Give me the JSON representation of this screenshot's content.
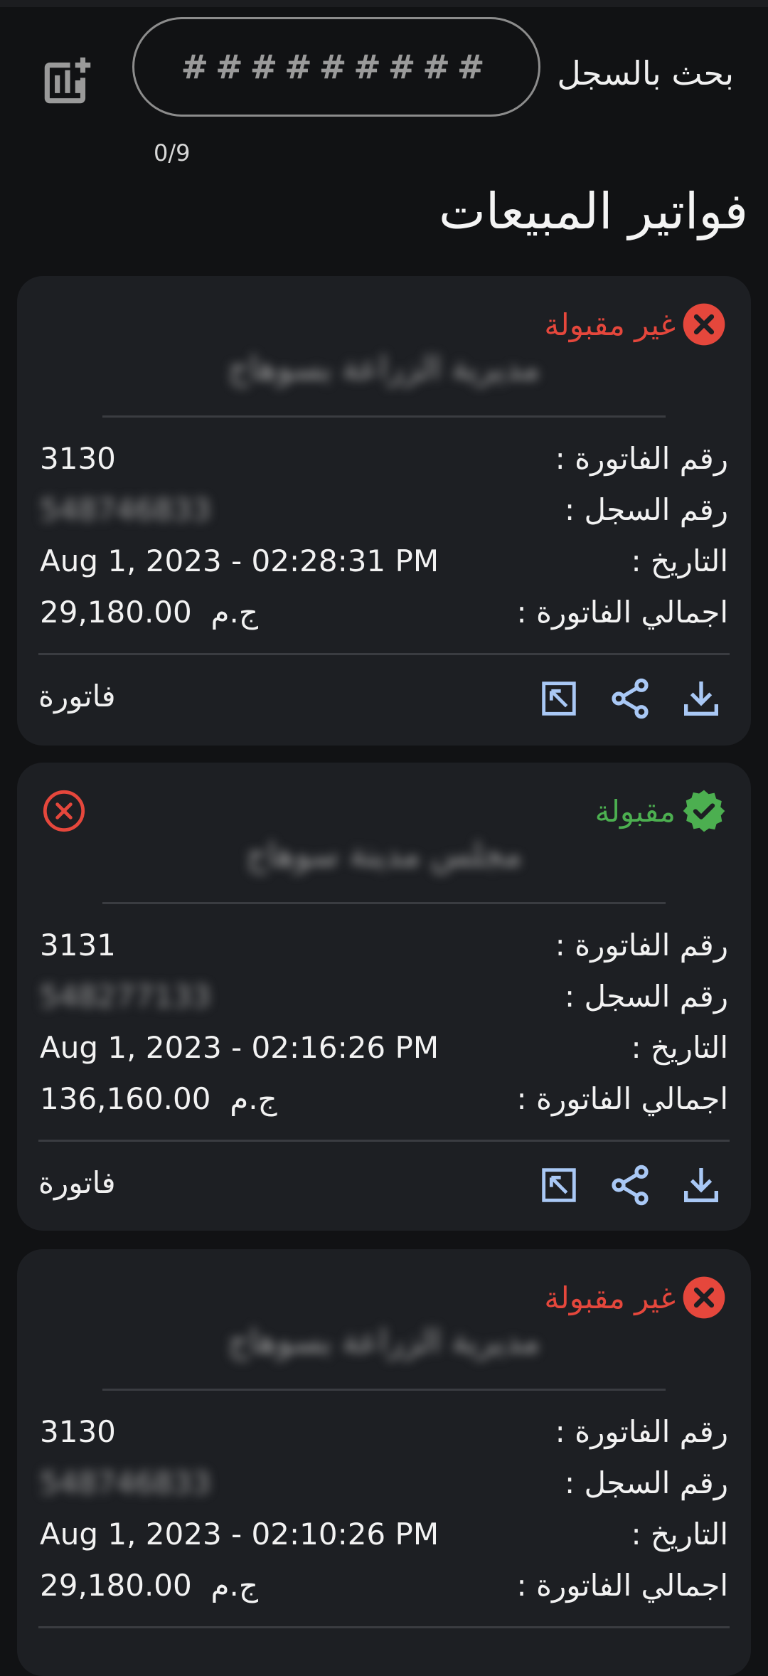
{
  "search": {
    "label": "بحث بالسجل",
    "value": "#########",
    "counter": "0/9"
  },
  "page_title": "فواتير المبيعات",
  "field_labels": {
    "invoice_number": "رقم الفاتورة :",
    "registry_number": "رقم السجل :",
    "date": "التاريخ :",
    "total": "اجمالي الفاتورة :"
  },
  "invoice_link_label": "فاتورة",
  "colors": {
    "rejected": "#e5473c",
    "accepted": "#4caf50",
    "action_icon": "#a9c8f5"
  },
  "invoices": [
    {
      "status": "غير مقبولة",
      "status_type": "rejected",
      "company_name": "مديرية الزراعة بسوهاج",
      "invoice_number": "3130",
      "registry_number": "548746833",
      "date": "Aug 1, 2023 - 02:28:31 PM",
      "total": "29,180.00",
      "currency": "ج.م"
    },
    {
      "status": "مقبولة",
      "status_type": "accepted",
      "company_name": "مجلس مدينة سوهاج",
      "invoice_number": "3131",
      "registry_number": "548277133",
      "date": "Aug 1, 2023 - 02:16:26 PM",
      "total": "136,160.00",
      "currency": "ج.م"
    },
    {
      "status": "غير مقبولة",
      "status_type": "rejected",
      "company_name": "مديرية الزراعة بسوهاج",
      "invoice_number": "3130",
      "registry_number": "548746833",
      "date": "Aug 1, 2023 - 02:10:26 PM",
      "total": "29,180.00",
      "currency": "ج.م"
    }
  ]
}
